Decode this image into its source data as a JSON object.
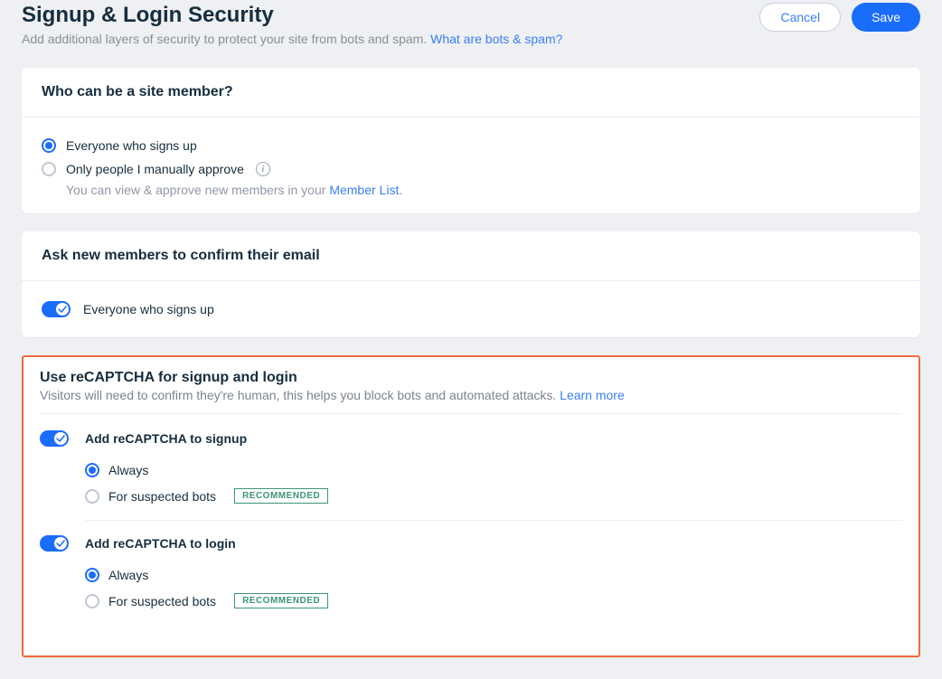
{
  "header": {
    "title": "Signup & Login Security",
    "subtitle": "Add additional layers of security to protect your site from bots and spam. ",
    "help_link": "What are bots & spam?",
    "cancel_label": "Cancel",
    "save_label": "Save"
  },
  "membership": {
    "title": "Who can be a site member?",
    "options": [
      {
        "label": "Everyone who signs up",
        "selected": true
      },
      {
        "label": "Only people I manually approve",
        "selected": false
      }
    ],
    "hint_prefix": "You can view & approve new members in your ",
    "hint_link": "Member List",
    "hint_suffix": "."
  },
  "confirm_email": {
    "title": "Ask new members to confirm their email",
    "toggle_label": "Everyone who signs up"
  },
  "recaptcha": {
    "title": "Use reCAPTCHA for signup and login",
    "subtitle_prefix": "Visitors will need to confirm they're human, this helps you block bots and automated attacks. ",
    "learn_more": "Learn more",
    "signup": {
      "label": "Add reCAPTCHA to signup",
      "options": [
        {
          "label": "Always",
          "selected": true
        },
        {
          "label": "For suspected bots",
          "selected": false
        }
      ]
    },
    "login": {
      "label": "Add reCAPTCHA to login",
      "options": [
        {
          "label": "Always",
          "selected": true
        },
        {
          "label": "For suspected bots",
          "selected": false
        }
      ]
    },
    "recommended_label": "RECOMMENDED"
  }
}
